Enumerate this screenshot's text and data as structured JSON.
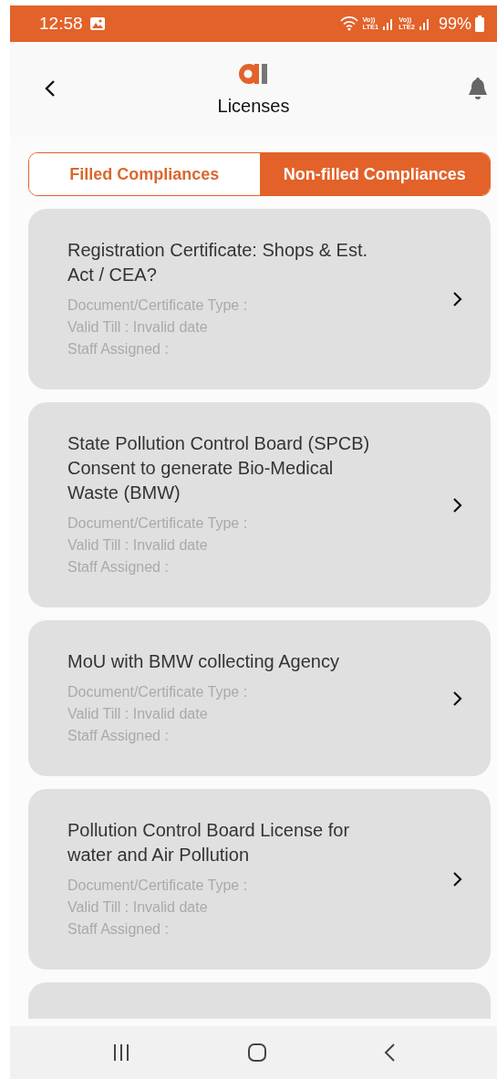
{
  "status_bar": {
    "time": "12:58",
    "sims": [
      {
        "top": "Vo))",
        "bottom": "LTE1"
      },
      {
        "top": "Vo))",
        "bottom": "LTE2"
      }
    ],
    "battery": "99%"
  },
  "header": {
    "title": "Licenses"
  },
  "tabs": [
    {
      "label": "Filled Compliances",
      "selected": false
    },
    {
      "label": "Non-filled Compliances",
      "selected": true
    }
  ],
  "cards": [
    {
      "title": "Registration Certificate: Shops & Est. Act / CEA?",
      "details": [
        "Document/Certificate Type :",
        "Valid Till : Invalid date",
        "Staff Assigned :"
      ]
    },
    {
      "title": "State Pollution Control Board (SPCB)\nConsent to generate Bio-Medical Waste (BMW)",
      "details": [
        "Document/Certificate Type :",
        "Valid Till : Invalid date",
        "Staff Assigned :"
      ]
    },
    {
      "title": "MoU with BMW collecting Agency",
      "details": [
        "Document/Certificate Type :",
        "Valid Till : Invalid date",
        "Staff Assigned :"
      ]
    },
    {
      "title": "Pollution Control Board License for water and Air Pollution",
      "details": [
        "Document/Certificate Type :",
        "Valid Till : Invalid date",
        "Staff Assigned :"
      ]
    }
  ]
}
